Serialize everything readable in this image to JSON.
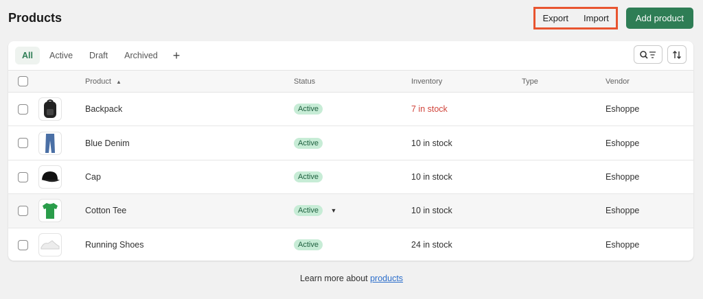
{
  "header": {
    "title": "Products",
    "export_label": "Export",
    "import_label": "Import",
    "add_label": "Add product",
    "highlight_color": "#e8542f",
    "primary_color": "#2e7d55"
  },
  "tabs": [
    {
      "label": "All",
      "active": true
    },
    {
      "label": "Active"
    },
    {
      "label": "Draft"
    },
    {
      "label": "Archived"
    }
  ],
  "add_tab_icon": "plus-icon",
  "toolbar": {
    "filter_icon": "search-filter-icon",
    "sort_icon": "sort-icon"
  },
  "table": {
    "columns": [
      "Product",
      "Status",
      "Inventory",
      "Type",
      "Vendor"
    ],
    "rows": [
      {
        "product": "Backpack",
        "status": "Active",
        "inventory": "7 in stock",
        "low": true,
        "type": "",
        "vendor": "Eshoppe",
        "image": "backpack"
      },
      {
        "product": "Blue Denim",
        "status": "Active",
        "inventory": "10 in stock",
        "type": "",
        "vendor": "Eshoppe",
        "image": "jeans"
      },
      {
        "product": "Cap",
        "status": "Active",
        "inventory": "10 in stock",
        "type": "",
        "vendor": "Eshoppe",
        "image": "cap"
      },
      {
        "product": "Cotton Tee",
        "status": "Active",
        "inventory": "10 in stock",
        "type": "",
        "vendor": "Eshoppe",
        "image": "tshirt"
      },
      {
        "product": "Running Shoes",
        "status": "Active",
        "inventory": "24 in stock",
        "type": "",
        "vendor": "Eshoppe",
        "image": "shoes"
      }
    ]
  },
  "footer": {
    "text": "Learn more about",
    "link": "products"
  }
}
